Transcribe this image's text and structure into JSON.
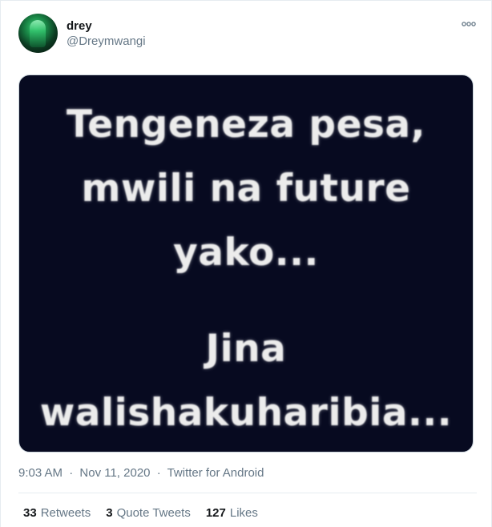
{
  "tweet": {
    "author": {
      "display_name": "drey",
      "handle": "@Dreymwangi",
      "avatar_icon": "user-avatar"
    },
    "more_icon": "more-options-icon",
    "media": {
      "background_color": "#070a20",
      "text_color": "#ececec",
      "lines": [
        "Tengeneza pesa,",
        "mwili na future",
        "yako..."
      ],
      "lines_2": [
        "Jina",
        "walishakuharibia..."
      ]
    },
    "meta": {
      "time": "9:03 AM",
      "date": "Nov 11, 2020",
      "separator": "·",
      "source": "Twitter for Android"
    },
    "stats": {
      "retweets_count": "33",
      "retweets_label": "Retweets",
      "quote_tweets_count": "3",
      "quote_tweets_label": "Quote Tweets",
      "likes_count": "127",
      "likes_label": "Likes"
    }
  }
}
